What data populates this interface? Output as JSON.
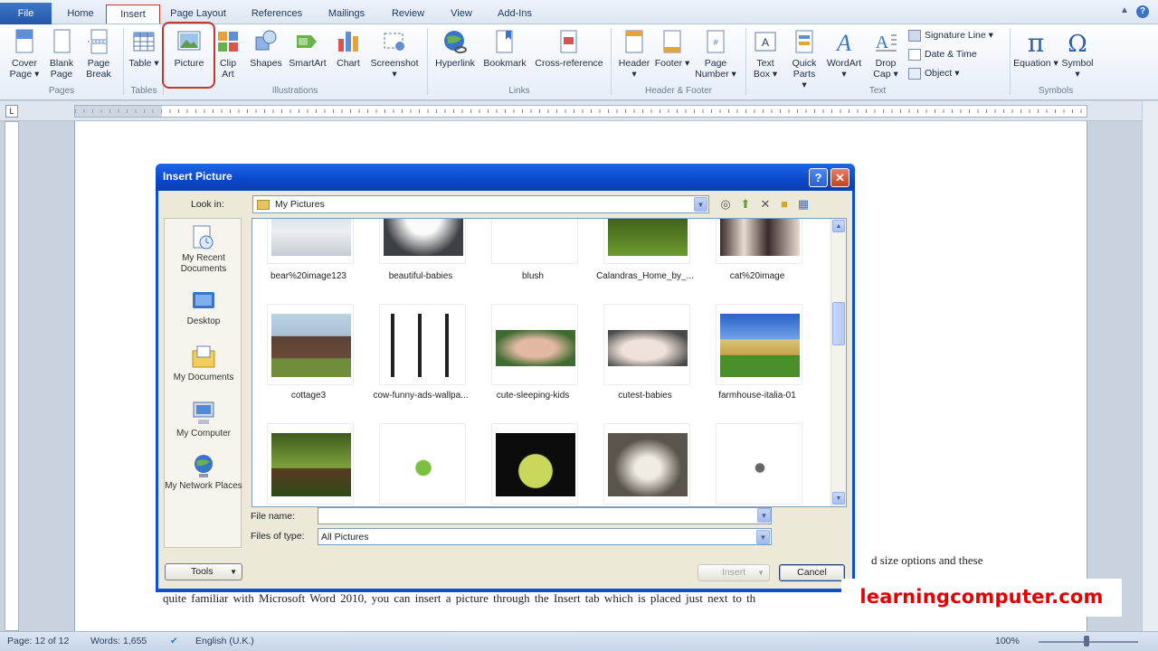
{
  "ribbon": {
    "tabs": [
      "File",
      "Home",
      "Insert",
      "Page Layout",
      "References",
      "Mailings",
      "Review",
      "View",
      "Add-Ins"
    ],
    "active_tab": "Insert",
    "groups": [
      {
        "label": "Pages",
        "buttons": [
          "Cover Page ▾",
          "Blank Page",
          "Page Break"
        ]
      },
      {
        "label": "Tables",
        "buttons": [
          "Table ▾"
        ]
      },
      {
        "label": "Illustrations",
        "buttons": [
          "Picture",
          "Clip Art",
          "Shapes",
          "SmartArt",
          "Chart",
          "Screenshot ▾"
        ]
      },
      {
        "label": "Links",
        "buttons": [
          "Hyperlink",
          "Bookmark",
          "Cross-reference"
        ]
      },
      {
        "label": "Header & Footer",
        "buttons": [
          "Header ▾",
          "Footer ▾",
          "Page Number ▾"
        ]
      },
      {
        "label": "Text",
        "buttons": [
          "Text Box ▾",
          "Quick Parts ▾",
          "WordArt ▾",
          "Drop Cap ▾"
        ]
      },
      {
        "label": "Symbols",
        "buttons": [
          "Equation ▾",
          "Symbol ▾"
        ]
      }
    ],
    "text_small": [
      "Signature Line ▾",
      "Date & Time",
      "Object ▾"
    ]
  },
  "document": {
    "line1": "d size options and these",
    "line2": "quite familiar with Microsoft Word 2010, you can insert a picture through the Insert tab which is placed just next to th"
  },
  "statusbar": {
    "page": "Page: 12 of 12",
    "words": "Words: 1,655",
    "language": "English (U.K.)",
    "zoom": "100%"
  },
  "dialog": {
    "title": "Insert Picture",
    "look_in_label": "Look in:",
    "look_in_value": "My Pictures",
    "places": [
      "My Recent Documents",
      "Desktop",
      "My Documents",
      "My Computer",
      "My Network Places"
    ],
    "row1": [
      "bear%20image123",
      "beautiful-babies",
      "blush",
      "Calandras_Home_by_...",
      "cat%20image"
    ],
    "row2": [
      "cottage3",
      "cow-funny-ads-wallpa...",
      "cute-sleeping-kids",
      "cutest-babies",
      "farmhouse-italia-01"
    ],
    "file_name_label": "File name:",
    "file_name_value": "",
    "files_of_type_label": "Files of type:",
    "files_of_type_value": "All Pictures",
    "tools_label": "Tools",
    "insert_label": "Insert",
    "cancel_label": "Cancel"
  },
  "watermark": "learningcomputer.com"
}
